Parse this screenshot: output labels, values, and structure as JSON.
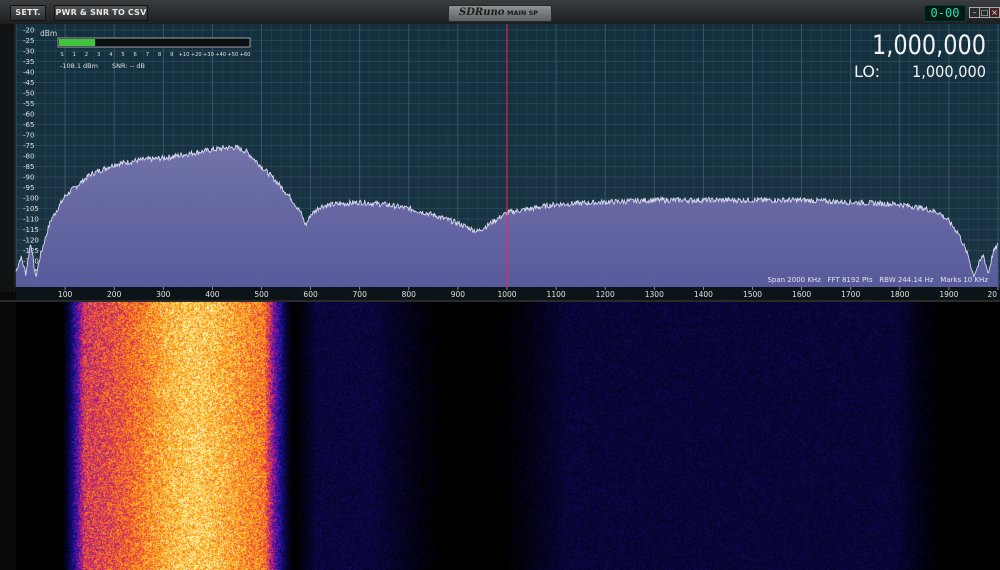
{
  "toolbar": {
    "sett_label": "SETT.",
    "csv_label": "PWR & SNR TO CSV",
    "logo_text": "SDRuno",
    "panel_name": "MAIN SP",
    "clock": "0-00"
  },
  "meter": {
    "unit": "dBm",
    "scale": [
      "S",
      "1",
      "2",
      "3",
      "4",
      "5",
      "6",
      "7",
      "8",
      "9",
      "+10",
      "+20",
      "+30",
      "+40",
      "+50",
      "+60"
    ],
    "level_fraction": 0.19,
    "power_readout": "-108.1 dBm",
    "snr_readout": "SNR: -- dB"
  },
  "frequency": {
    "main": "1,000,000",
    "lo_label": "LO:",
    "lo_value": "1,000,000"
  },
  "info_bar": "Span 2000 KHz   FFT 8192 Pts   RBW 244.14 Hz   Marks 10 KHz",
  "colors": {
    "accent": "#28e0b0",
    "marker": "#ff2050",
    "fill": "#6e6ea8"
  },
  "chart_data": {
    "type": "area",
    "title": "",
    "xlabel": "",
    "ylabel": "dBm",
    "xlim": [
      0,
      2000
    ],
    "ylim": [
      -140,
      -20
    ],
    "x_ticks": [
      "100",
      "200",
      "300",
      "400",
      "500",
      "600",
      "700",
      "800",
      "900",
      "1000",
      "1100",
      "1200",
      "1300",
      "1400",
      "1500",
      "1600",
      "1700",
      "1800",
      "1900",
      "20"
    ],
    "y_ticks": [
      "-20",
      "-25",
      "-30",
      "-35",
      "-40",
      "-45",
      "-50",
      "-55",
      "-60",
      "-65",
      "-70",
      "-75",
      "-80",
      "-85",
      "-90",
      "-95",
      "-100",
      "-105",
      "-110",
      "-115",
      "-120",
      "-125",
      "-130",
      "-135",
      "-140"
    ],
    "marker_x": 1000,
    "series": [
      {
        "x": [
          0,
          10,
          20,
          30,
          40,
          50,
          70,
          100,
          150,
          200,
          250,
          300,
          350,
          400,
          430,
          450,
          470,
          500,
          530,
          560,
          580,
          590,
          600,
          620,
          650,
          700,
          750,
          800,
          850,
          900,
          940,
          960,
          1000,
          1050,
          1100,
          1200,
          1300,
          1400,
          1500,
          1600,
          1700,
          1800,
          1850,
          1880,
          1900,
          1920,
          1940,
          1950,
          1960,
          1970,
          1980,
          1990,
          2000
        ],
        "y": [
          -135,
          -128,
          -136,
          -121,
          -138,
          -127,
          -111,
          -99,
          -89,
          -84,
          -82,
          -81,
          -79,
          -77,
          -76,
          -76,
          -78,
          -85,
          -92,
          -100,
          -107,
          -113,
          -108,
          -104,
          -103,
          -102,
          -103,
          -105,
          -108,
          -112,
          -116,
          -113,
          -107,
          -105,
          -103,
          -102,
          -101,
          -101,
          -101,
          -101,
          -102,
          -103,
          -105,
          -107,
          -111,
          -117,
          -128,
          -137,
          -132,
          -127,
          -136,
          -126,
          -122
        ]
      }
    ]
  }
}
